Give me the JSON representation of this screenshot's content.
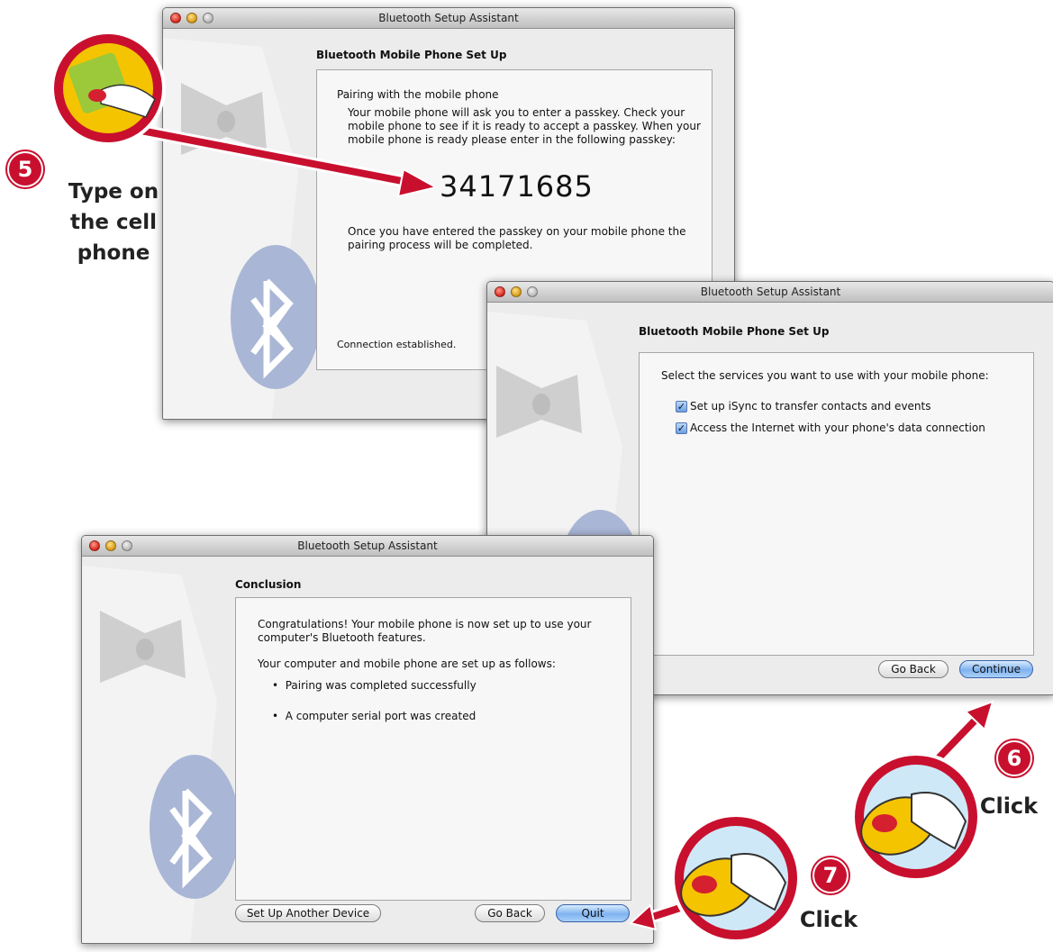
{
  "window1": {
    "title": "Bluetooth Setup Assistant",
    "heading": "Bluetooth Mobile Phone Set Up",
    "section_title": "Pairing with the mobile phone",
    "instructions": "Your mobile phone will ask you to enter a passkey. Check your mobile phone to see if it is ready to accept a passkey. When your mobile phone is ready please enter in the following passkey:",
    "passkey": "34171685",
    "after_text": "Once you have entered the passkey on your mobile phone the pairing process will be completed.",
    "status": "Connection established."
  },
  "window2": {
    "title": "Bluetooth Setup Assistant",
    "heading": "Bluetooth Mobile Phone Set Up",
    "prompt": "Select the services you want to use with your mobile phone:",
    "options": [
      {
        "label": "Set up iSync to transfer contacts and events",
        "checked": true
      },
      {
        "label": "Access the Internet with your phone's data connection",
        "checked": true
      }
    ],
    "back_label": "Go Back",
    "continue_label": "Continue"
  },
  "window3": {
    "title": "Bluetooth Setup Assistant",
    "heading": "Conclusion",
    "congrats": "Congratulations! Your mobile phone is now set up to use your computer's Bluetooth features.",
    "setup_intro": "Your computer and mobile phone are set up as follows:",
    "bullets": [
      "Pairing was completed successfully",
      "A computer serial port was created"
    ],
    "another_label": "Set Up Another Device",
    "back_label": "Go Back",
    "quit_label": "Quit"
  },
  "callouts": {
    "step5": {
      "number": "5",
      "line1": "Type on",
      "line2": "the cell",
      "line3": "phone"
    },
    "step6": {
      "number": "6",
      "label": "Click"
    },
    "step7": {
      "number": "7",
      "label": "Click"
    }
  },
  "colors": {
    "callout_red": "#c8102e",
    "accent_yellow": "#f5c400",
    "button_blue": "#7fb2ef"
  }
}
